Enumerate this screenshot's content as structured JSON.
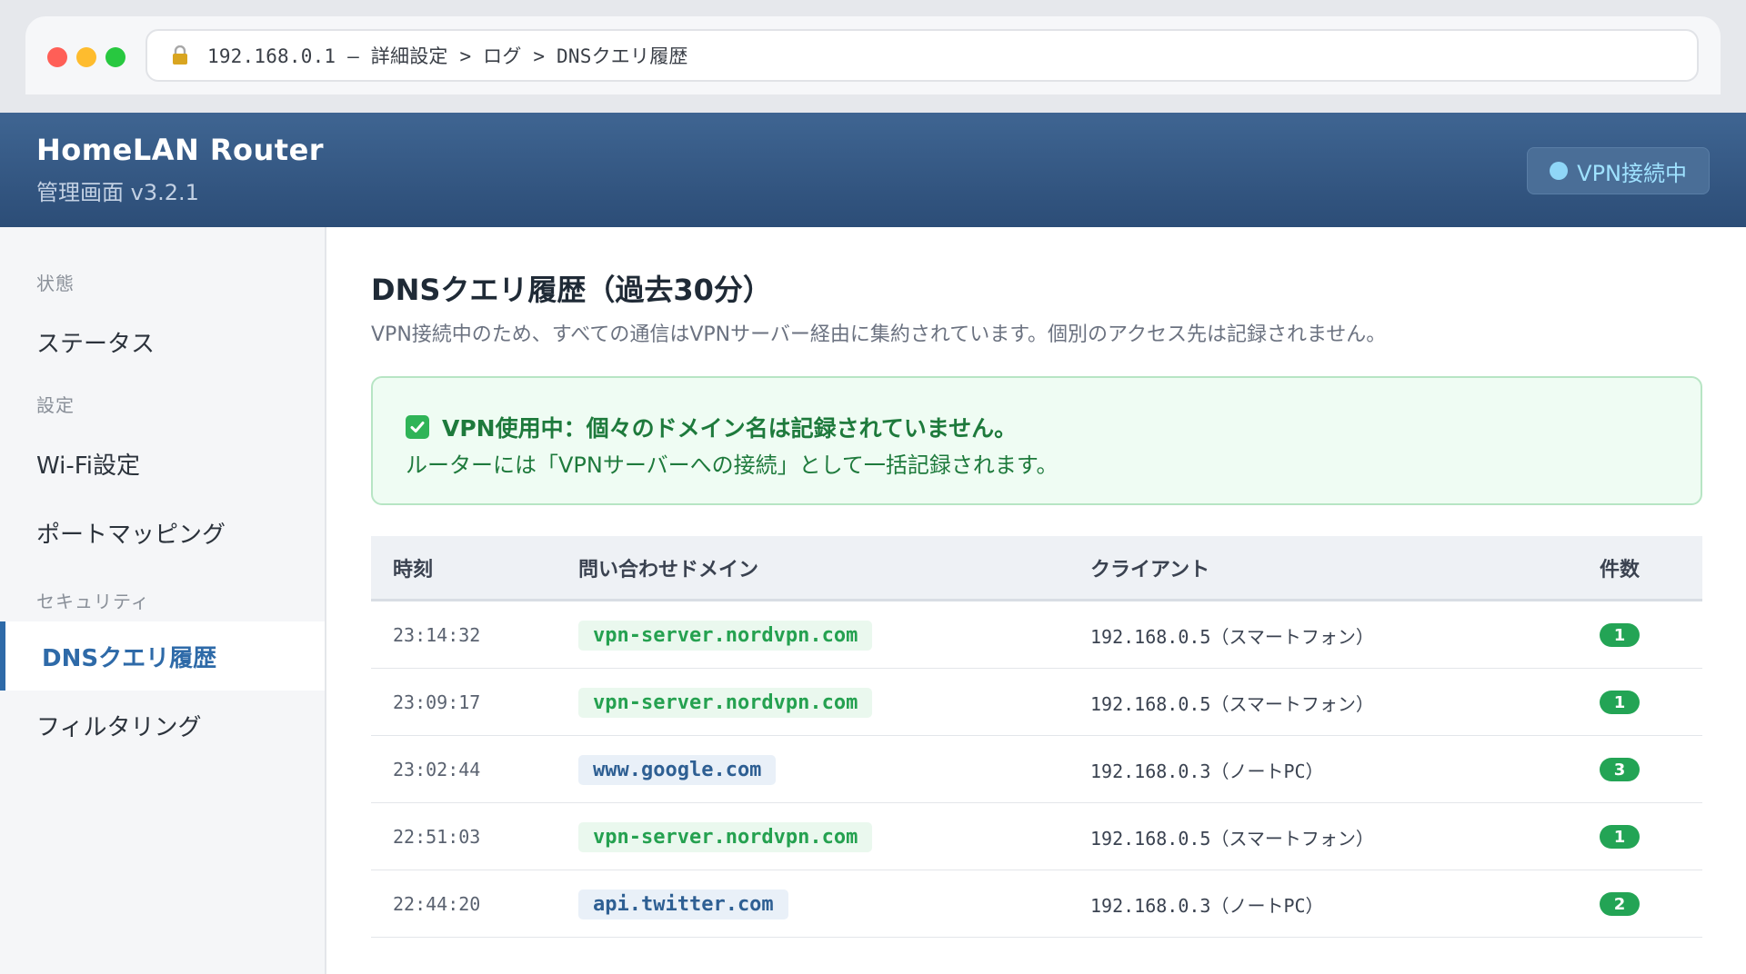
{
  "browser": {
    "url": "192.168.0.1 — 詳細設定 > ログ > DNSクエリ履歴"
  },
  "header": {
    "title": "HomeLAN Router",
    "subtitle": "管理画面 v3.2.1",
    "vpn_status": "VPN接続中"
  },
  "sidebar": {
    "sections": [
      {
        "label": "状態"
      },
      {
        "label": "設定"
      },
      {
        "label": "セキュリティ"
      }
    ],
    "items": [
      {
        "label": "ステータス"
      },
      {
        "label": "Wi-Fi設定"
      },
      {
        "label": "ポートマッピング"
      },
      {
        "label": "DNSクエリ履歴"
      },
      {
        "label": "フィルタリング"
      }
    ]
  },
  "main": {
    "title": "DNSクエリ履歴（過去30分）",
    "description": "VPN接続中のため、すべての通信はVPNサーバー経由に集約されています。個別のアクセス先は記録されません。",
    "alert": {
      "headline": "VPN使用中：個々のドメイン名は記録されていません。",
      "detail": "ルーターには「VPNサーバーへの接続」として一括記録されます。"
    },
    "table": {
      "headers": {
        "time": "時刻",
        "domain": "問い合わせドメイン",
        "client": "クライアント",
        "count": "件数"
      },
      "rows": [
        {
          "time": "23:14:32",
          "domain": "vpn-server.nordvpn.com",
          "client": "192.168.0.5（スマートフォン）",
          "count": "1"
        },
        {
          "time": "23:09:17",
          "domain": "vpn-server.nordvpn.com",
          "client": "192.168.0.5（スマートフォン）",
          "count": "1"
        },
        {
          "time": "23:02:44",
          "domain": "www.google.com",
          "client": "192.168.0.3（ノートPC）",
          "count": "3"
        },
        {
          "time": "22:51:03",
          "domain": "vpn-server.nordvpn.com",
          "client": "192.168.0.5（スマートフォン）",
          "count": "1"
        },
        {
          "time": "22:44:20",
          "domain": "api.twitter.com",
          "client": "192.168.0.3（ノートPC）",
          "count": "2"
        }
      ]
    }
  },
  "colors": {
    "header_bg": "#34587f",
    "accent": "#2e6aa8",
    "success": "#23a455",
    "vpn_domain": "#25a150",
    "other_domain": "#2e5f93"
  }
}
